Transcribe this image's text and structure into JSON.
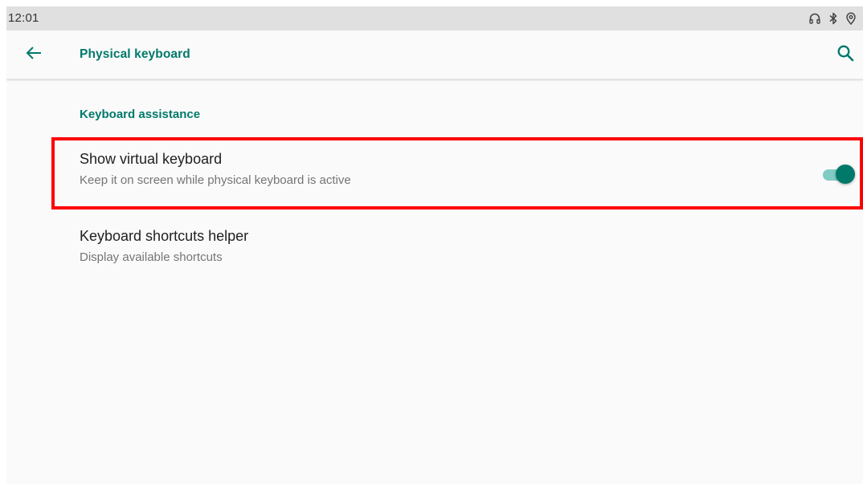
{
  "status_bar": {
    "time": "12:01",
    "icons": [
      "headphones-icon",
      "bluetooth-icon",
      "location-icon"
    ]
  },
  "app_bar": {
    "back_icon": "arrow-back-icon",
    "title": "Physical keyboard",
    "search_icon": "search-icon"
  },
  "section": {
    "header": "Keyboard assistance"
  },
  "preferences": [
    {
      "title": "Show virtual keyboard",
      "summary": "Keep it on screen while physical keyboard is active",
      "toggle_state": "on"
    },
    {
      "title": "Keyboard shortcuts helper",
      "summary": "Display available shortcuts"
    }
  ],
  "colors": {
    "accent": "#00796b",
    "switch_track": "#80cbc4",
    "highlight": "#ff0000",
    "status_bar_bg": "#e0e0e0",
    "background": "#fafafa"
  }
}
